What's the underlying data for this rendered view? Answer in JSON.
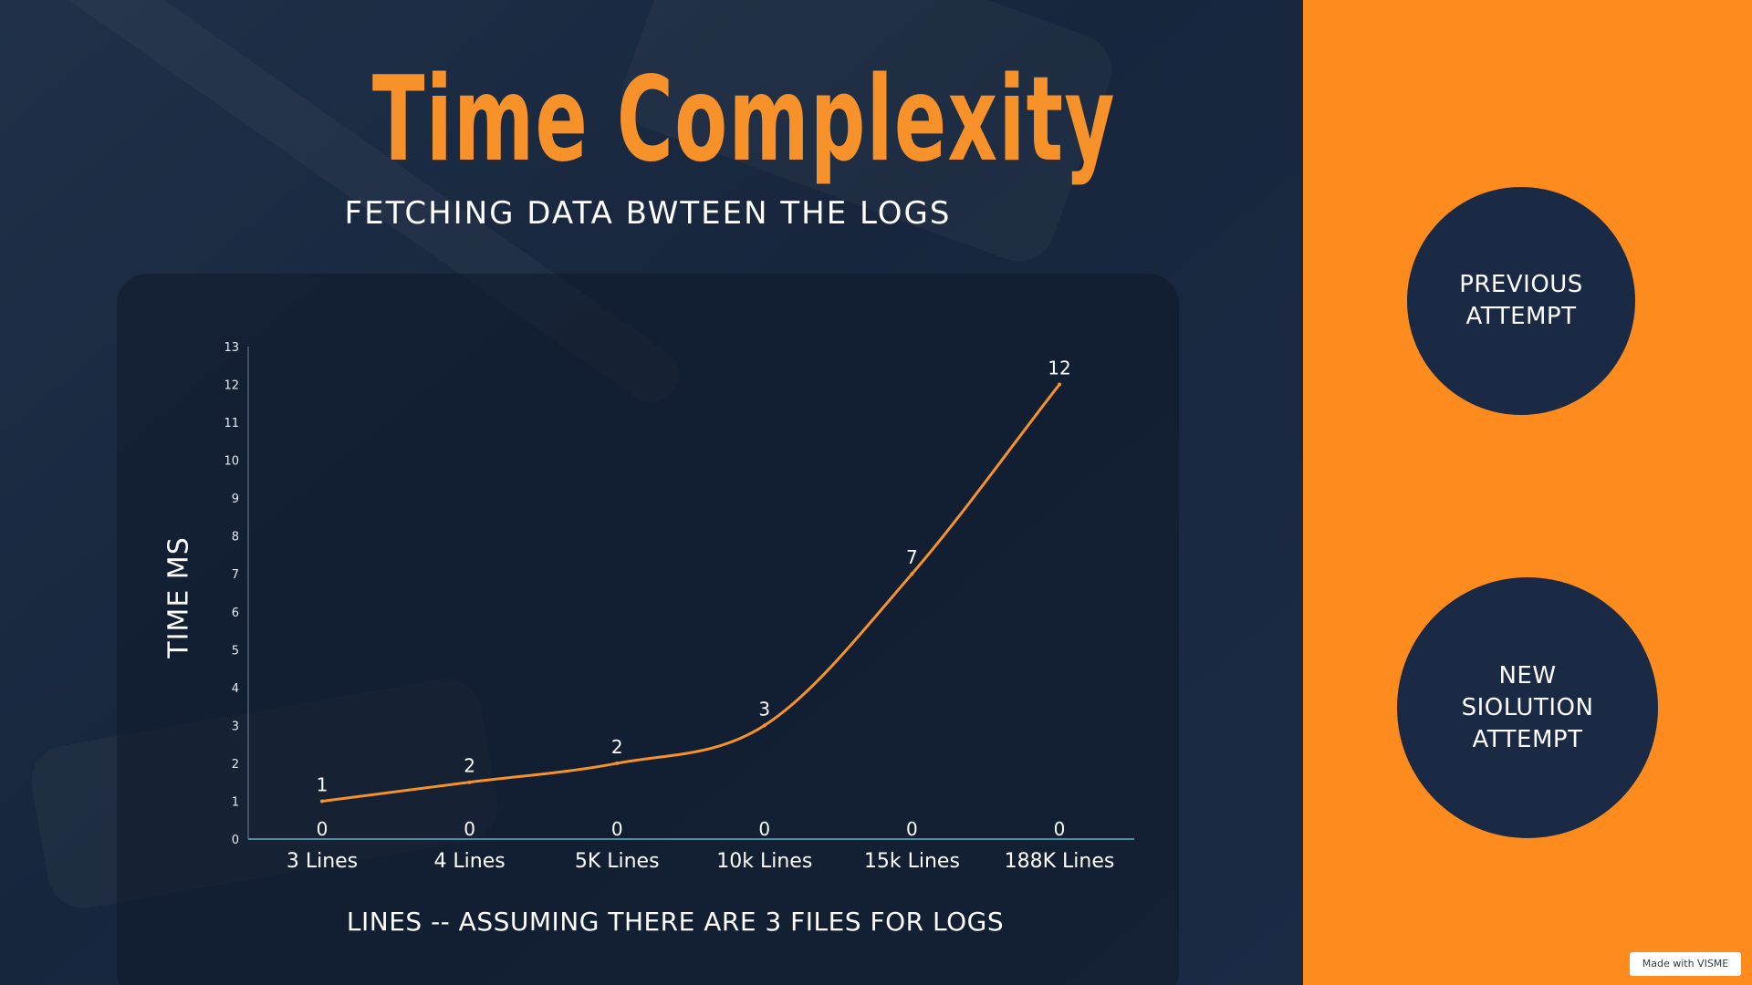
{
  "slide": {
    "title": "Time Complexity",
    "subtitle": "FETCHING DATA BWTEEN THE LOGS",
    "accent_color": "#f7922b",
    "panel_color": "#fd8b1e",
    "background_color": "#1a2a45"
  },
  "buttons": {
    "previous_attempt": "PREVIOUS\nATTEMPT",
    "new_solution_attempt": "NEW\nSIOLUTION\nATTEMPT"
  },
  "badge": "Made with VISME",
  "chart_data": {
    "type": "line",
    "xlabel": "LINES -- ASSUMING THERE ARE 3 FILES FOR LOGS",
    "ylabel": "TIME MS",
    "ylim": [
      0,
      13
    ],
    "y_ticks": [
      0,
      1,
      2,
      3,
      4,
      5,
      6,
      7,
      8,
      9,
      10,
      11,
      12,
      13
    ],
    "categories": [
      "3 Lines",
      "4 Lines",
      "5K Lines",
      "10k Lines",
      "15k Lines",
      "188K Lines"
    ],
    "series": [
      {
        "values": [
          1,
          1.5,
          2,
          3,
          7,
          12
        ],
        "data_labels": [
          "1",
          "2",
          "2",
          "3",
          "7",
          "12"
        ],
        "color": "#f7922b",
        "smooth": true
      },
      {
        "values": [
          0,
          0,
          0,
          0,
          0,
          0
        ],
        "data_labels": [
          "0",
          "0",
          "0",
          "0",
          "0",
          "0"
        ],
        "color": "#4a8fa0"
      }
    ],
    "grid": false,
    "legend": "none"
  }
}
